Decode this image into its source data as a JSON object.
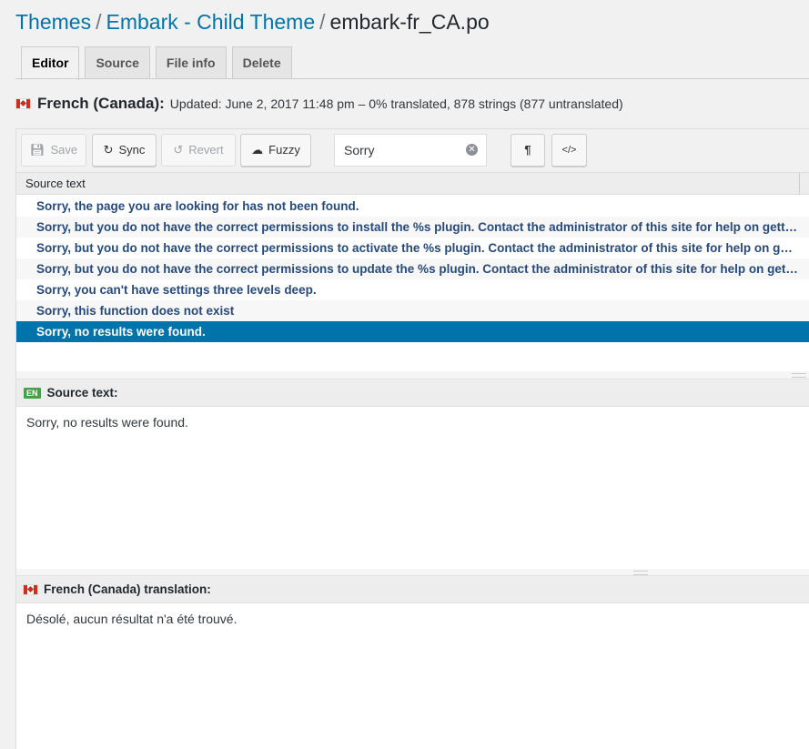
{
  "breadcrumb": {
    "items": [
      "Themes",
      "Embark - Child Theme"
    ],
    "separator": "/",
    "current": "embark-fr_CA.po"
  },
  "tabs": [
    {
      "label": "Editor",
      "active": true
    },
    {
      "label": "Source",
      "active": false
    },
    {
      "label": "File info",
      "active": false
    },
    {
      "label": "Delete",
      "active": false
    }
  ],
  "locale": {
    "name": "French (Canada):",
    "info": "Updated: June 2, 2017 11:48 pm – 0% translated, 878 strings (877 untranslated)",
    "flag_icon": "flag-ca-icon"
  },
  "toolbar": {
    "save": "Save",
    "sync": "Sync",
    "revert": "Revert",
    "fuzzy": "Fuzzy",
    "search_value": "Sorry",
    "pilcrow": "¶",
    "code": "</>"
  },
  "list": {
    "header": "Source text",
    "rows": [
      "Sorry, the page you are looking for has not been found.",
      "Sorry, but you do not have the correct permissions to install the %s plugin. Contact the administrator of this site for help on getting the plugin installed.",
      "Sorry, but you do not have the correct permissions to activate the %s plugin. Contact the administrator of this site for help on getting the plugin activated.",
      "Sorry, but you do not have the correct permissions to update the %s plugin. Contact the administrator of this site for help on getting the plugin updated.",
      "Sorry, you can't have settings three levels deep.",
      "Sorry, this function does not exist",
      "Sorry, no results were found."
    ],
    "selected_index": 6
  },
  "source_pane": {
    "badge": "EN",
    "title": "Source text:",
    "text": "Sorry, no results were found."
  },
  "translation_pane": {
    "title": "French (Canada) translation:",
    "text": "Désolé, aucun résultat n'a été trouvé."
  },
  "colors": {
    "link": "#0073aa",
    "row_text": "#274a7a",
    "selected_row": "#0073aa",
    "badge_en": "#46a046"
  }
}
